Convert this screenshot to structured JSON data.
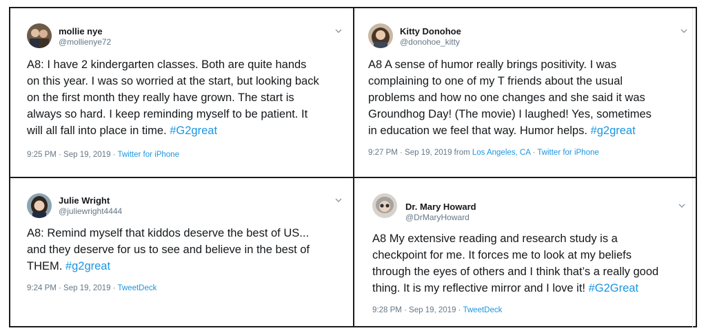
{
  "tweets": [
    {
      "name": "mollie nye",
      "handle": "@mollienye72",
      "lines": [
        "A8: I have 2 kindergarten classes. Both are quite hands",
        "on this year. I was so worried at the start, but looking back",
        "on the first month they really have grown. The start is",
        "always so hard. I keep reminding myself to be patient. It"
      ],
      "last_line": "will all fall into place in time. ",
      "hashtag": "#G2great",
      "time": "9:25 PM · Sep 19, 2019 · ",
      "source": "Twitter for iPhone"
    },
    {
      "name": "Kitty Donohoe",
      "handle": "@donohoe_kitty",
      "lines": [
        "A8 A sense of humor really brings positivity. I was",
        "complaining to one of my T friends about the usual",
        "problems and how no one changes and she said it was",
        "Groundhog Day! (The movie) I laughed! Yes, sometimes"
      ],
      "last_line": "in education we feel that way. Humor helps. ",
      "hashtag": "#g2great",
      "time": "9:27 PM · Sep 19, 2019 from ",
      "location": "Los Angeles, CA",
      "time_sep": " · ",
      "source": "Twitter for iPhone"
    },
    {
      "name": "Julie Wright",
      "handle": "@juliewright4444",
      "lines": [
        "A8: Remind myself that kiddos deserve the best of US...",
        "and they deserve for us to see and believe in the best of"
      ],
      "last_line": "THEM. ",
      "hashtag": "#g2great",
      "time": "9:24 PM · Sep 19, 2019 · ",
      "source": "TweetDeck"
    },
    {
      "name": "Dr. Mary Howard",
      "handle": "@DrMaryHoward",
      "lines": [
        "A8 My extensive reading and research study is a",
        "checkpoint for me. It forces me to look at my beliefs",
        "through the eyes of others and I think that’s a really good"
      ],
      "last_line": "thing. It is my reflective mirror and I love it! ",
      "hashtag": "#G2Great",
      "time": "9:28 PM · Sep 19, 2019 · ",
      "source": "TweetDeck"
    }
  ],
  "colors": {
    "link": "#1b95e0",
    "secondary": "#657786",
    "text": "#14171a"
  }
}
